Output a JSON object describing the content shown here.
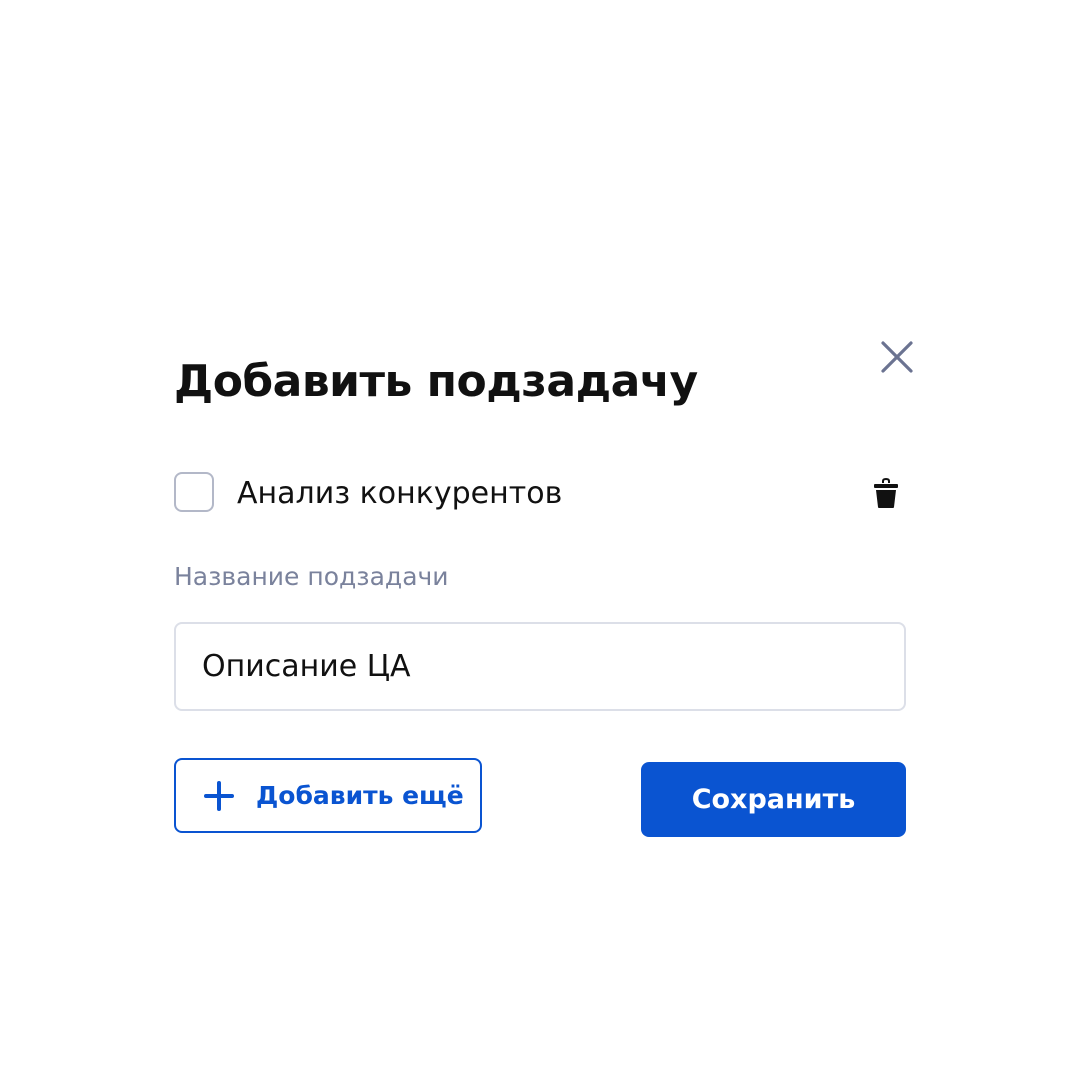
{
  "dialog": {
    "title": "Добавить подзадачу",
    "close_icon": "close-icon"
  },
  "subtask": {
    "label": "Анализ конкурентов",
    "checked": false,
    "delete_icon": "trash-icon"
  },
  "field": {
    "label": "Название подзадачи",
    "value": "Описание ЦА"
  },
  "actions": {
    "add_more_label": "Добавить ещё",
    "add_more_icon": "plus-icon",
    "save_label": "Сохранить"
  },
  "colors": {
    "accent": "#0a54d1",
    "muted_text": "#7a829c",
    "border": "#dcdfe8",
    "checkbox_border": "#b3b8c8",
    "close_icon": "#6b7391"
  }
}
